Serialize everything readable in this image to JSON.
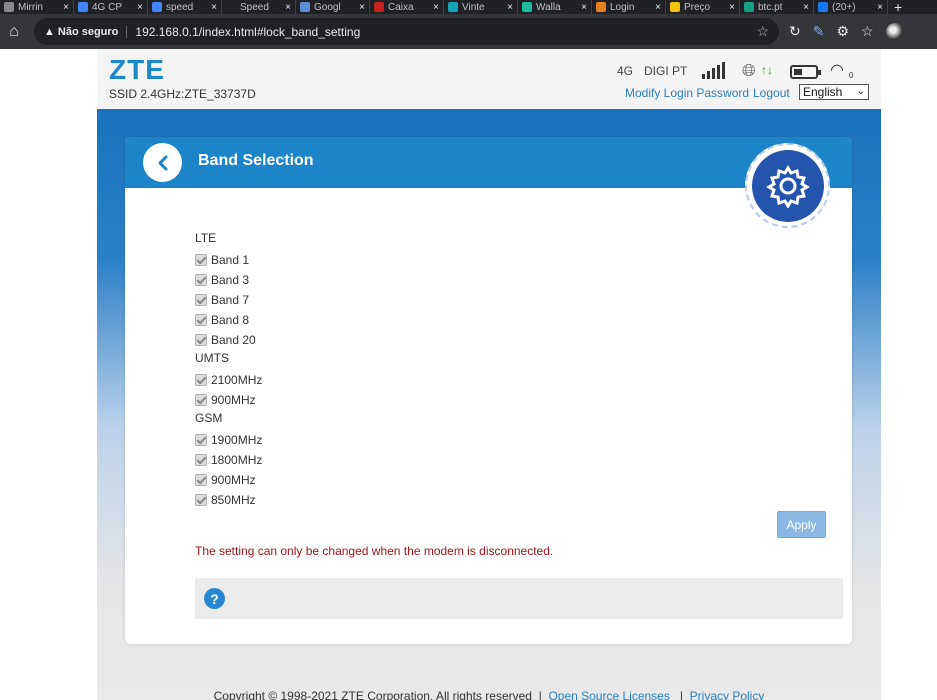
{
  "browser": {
    "tabs": [
      {
        "title": "Mirrin",
        "color": "#888888"
      },
      {
        "title": "4G CP",
        "color": "#4285f4"
      },
      {
        "title": "speed",
        "color": "#4285f4"
      },
      {
        "title": "Speed",
        "color": "#222222"
      },
      {
        "title": "Googl",
        "color": "#5f8dd3"
      },
      {
        "title": "Caixa",
        "color": "#c5221f"
      },
      {
        "title": "Vinte",
        "color": "#17a2b8"
      },
      {
        "title": "Walla",
        "color": "#1abc9c"
      },
      {
        "title": "Login",
        "color": "#e67e22"
      },
      {
        "title": "Preço",
        "color": "#f1c40f"
      },
      {
        "title": "btc.pt",
        "color": "#16a085"
      },
      {
        "title": "(20+)",
        "color": "#1877f2"
      }
    ],
    "close_glyph": "×",
    "new_tab_glyph": "+",
    "security_label": "Não seguro",
    "url": "192.168.0.1/index.html#lock_band_setting"
  },
  "header": {
    "logo": "ZTE",
    "ssid": "SSID 2.4GHz:ZTE_33737D",
    "network_mode": "4G",
    "carrier": "DIGI PT",
    "wifi_clients": "0",
    "modify_password_label": "Modify Login Password",
    "logout_label": "Logout",
    "language": "English"
  },
  "panel": {
    "title": "Band Selection",
    "groups": [
      {
        "label": "LTE",
        "bands": [
          "Band 1",
          "Band 3",
          "Band 7",
          "Band 8",
          "Band 20"
        ]
      },
      {
        "label": "UMTS",
        "bands": [
          "2100MHz",
          "900MHz"
        ]
      },
      {
        "label": "GSM",
        "bands": [
          "1900MHz",
          "1800MHz",
          "900MHz",
          "850MHz"
        ]
      }
    ],
    "apply_label": "Apply",
    "notice": "The setting can only be changed when the modem is disconnected.",
    "help_glyph": "?"
  },
  "footer": {
    "copyright": "Copyright © 1998-2021 ZTE Corporation. All rights reserved",
    "separator": "|",
    "open_source_label": "Open Source Licenses",
    "privacy_label": "Privacy Policy"
  }
}
